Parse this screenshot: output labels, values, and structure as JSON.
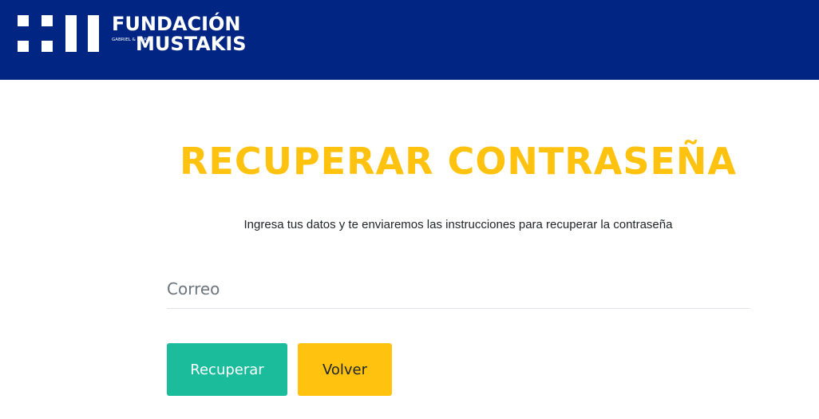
{
  "header": {
    "brand": {
      "line1": "FUNDACIÓN",
      "small_text": "GABRIEL & MARY",
      "line2": "MUSTAKIS"
    }
  },
  "main": {
    "title": "RECUPERAR CONTRASEÑA",
    "subtitle": "Ingresa tus datos y te enviaremos las instrucciones para recuperar la contraseña",
    "email": {
      "value": "",
      "placeholder": "Correo"
    },
    "buttons": {
      "recover_label": "Recuperar",
      "back_label": "Volver"
    }
  },
  "colors": {
    "header_bg": "#002583",
    "title": "#ffc20e",
    "primary_button": "#1abc9c",
    "secondary_button": "#ffc20e"
  }
}
